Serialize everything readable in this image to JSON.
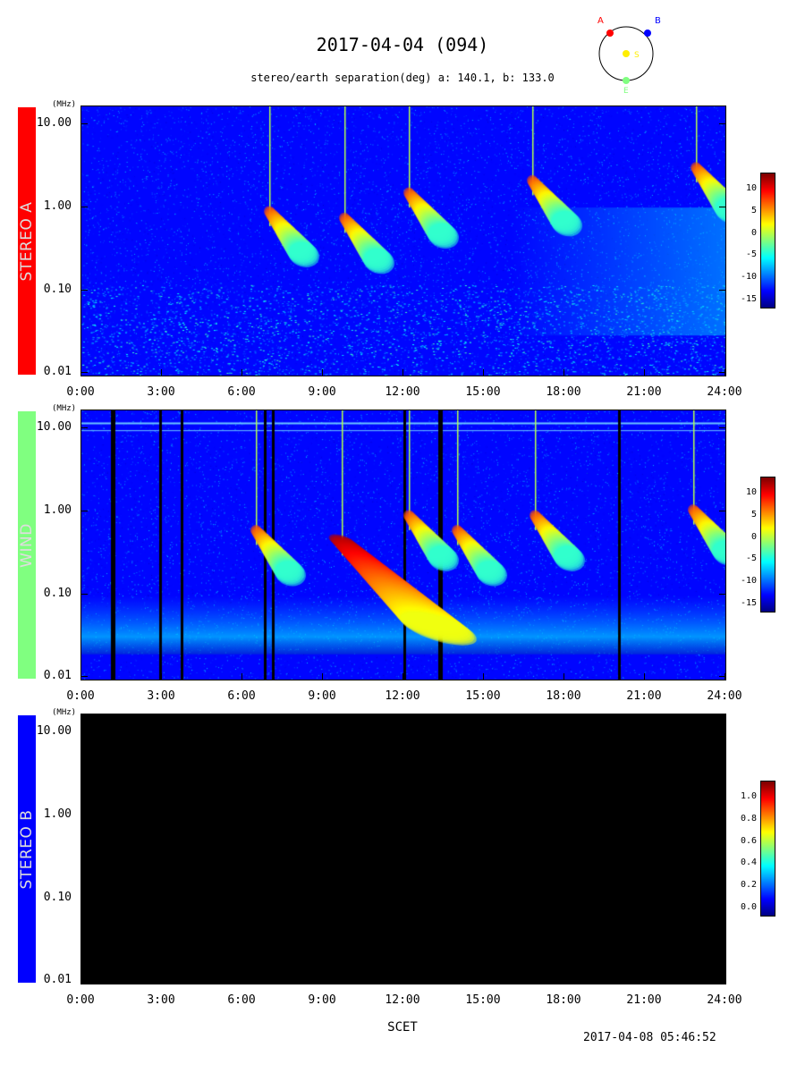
{
  "title": "2017-04-04 (094)",
  "subtitle": "stereo/earth separation(deg) a: 140.1, b: 133.0",
  "orbit_diagram": {
    "labels": {
      "a": "A",
      "b": "B",
      "s": "S",
      "e": "E"
    },
    "colors": {
      "a": "#ff0000",
      "b": "#0000ff",
      "s": "#ffee00",
      "e": "#80ff80"
    }
  },
  "x_axis": {
    "label": "SCET",
    "ticks": [
      "0:00",
      "3:00",
      "6:00",
      "9:00",
      "12:00",
      "15:00",
      "18:00",
      "21:00",
      "24:00"
    ]
  },
  "y_axis": {
    "unit": "(MHz)",
    "ticks": [
      "10.00",
      "1.00",
      "0.10",
      "0.01"
    ]
  },
  "panels": [
    {
      "name": "STEREO A",
      "label_bg": "#ff0000",
      "label_fg": "#dddddd",
      "cbar_ticks": [
        "10",
        "5",
        "0",
        "-5",
        "-10",
        "-15"
      ]
    },
    {
      "name": "WIND",
      "label_bg": "#80ff80",
      "label_fg": "#dddddd",
      "cbar_ticks": [
        "10",
        "5",
        "0",
        "-5",
        "-10",
        "-15"
      ]
    },
    {
      "name": "STEREO B",
      "label_bg": "#0000ff",
      "label_fg": "#dddddd",
      "cbar_ticks": [
        "1.0",
        "0.8",
        "0.6",
        "0.4",
        "0.2",
        "0.0"
      ]
    }
  ],
  "footer": "2017-04-08 05:46:52",
  "chart_data": [
    {
      "type": "heatmap",
      "panel": "STEREO A",
      "x": [
        "0:00",
        "3:00",
        "6:00",
        "9:00",
        "12:00",
        "15:00",
        "18:00",
        "21:00",
        "24:00"
      ],
      "xlim_hours": [
        0,
        24
      ],
      "ylim_mhz": [
        0.01,
        16
      ],
      "y_scale": "log",
      "colorbar_range": [
        -15,
        15
      ],
      "features": [
        {
          "desc": "type III burst",
          "start_hour": 7.0,
          "peak_freq_mhz": 0.3
        },
        {
          "desc": "type III burst",
          "start_hour": 9.8,
          "peak_freq_mhz": 0.25
        },
        {
          "desc": "type III burst",
          "start_hour": 12.2,
          "peak_freq_mhz": 0.5
        },
        {
          "desc": "type III burst",
          "start_hour": 16.8,
          "peak_freq_mhz": 0.7
        },
        {
          "desc": "type III burst",
          "start_hour": 22.9,
          "peak_freq_mhz": 1.0
        }
      ]
    },
    {
      "type": "heatmap",
      "panel": "WIND",
      "x": [
        "0:00",
        "3:00",
        "6:00",
        "9:00",
        "12:00",
        "15:00",
        "18:00",
        "21:00",
        "24:00"
      ],
      "xlim_hours": [
        0,
        24
      ],
      "ylim_mhz": [
        0.01,
        16
      ],
      "y_scale": "log",
      "colorbar_range": [
        -15,
        10
      ],
      "features": [
        {
          "desc": "type III burst",
          "start_hour": 6.5,
          "peak_freq_mhz": 0.2
        },
        {
          "desc": "type III burst group",
          "start_hour": 9.7,
          "peak_freq_mhz": 0.15
        },
        {
          "desc": "type III burst",
          "start_hour": 12.2,
          "peak_freq_mhz": 0.3
        },
        {
          "desc": "type III burst",
          "start_hour": 14.0,
          "peak_freq_mhz": 0.2
        },
        {
          "desc": "type III burst",
          "start_hour": 16.9,
          "peak_freq_mhz": 0.3
        },
        {
          "desc": "type III burst",
          "start_hour": 22.8,
          "peak_freq_mhz": 0.35
        }
      ]
    },
    {
      "type": "heatmap",
      "panel": "STEREO B",
      "x": [
        "0:00",
        "3:00",
        "6:00",
        "9:00",
        "12:00",
        "15:00",
        "18:00",
        "21:00",
        "24:00"
      ],
      "xlim_hours": [
        0,
        24
      ],
      "ylim_mhz": [
        0.01,
        16
      ],
      "y_scale": "log",
      "colorbar_range": [
        0,
        1
      ],
      "features": []
    }
  ]
}
